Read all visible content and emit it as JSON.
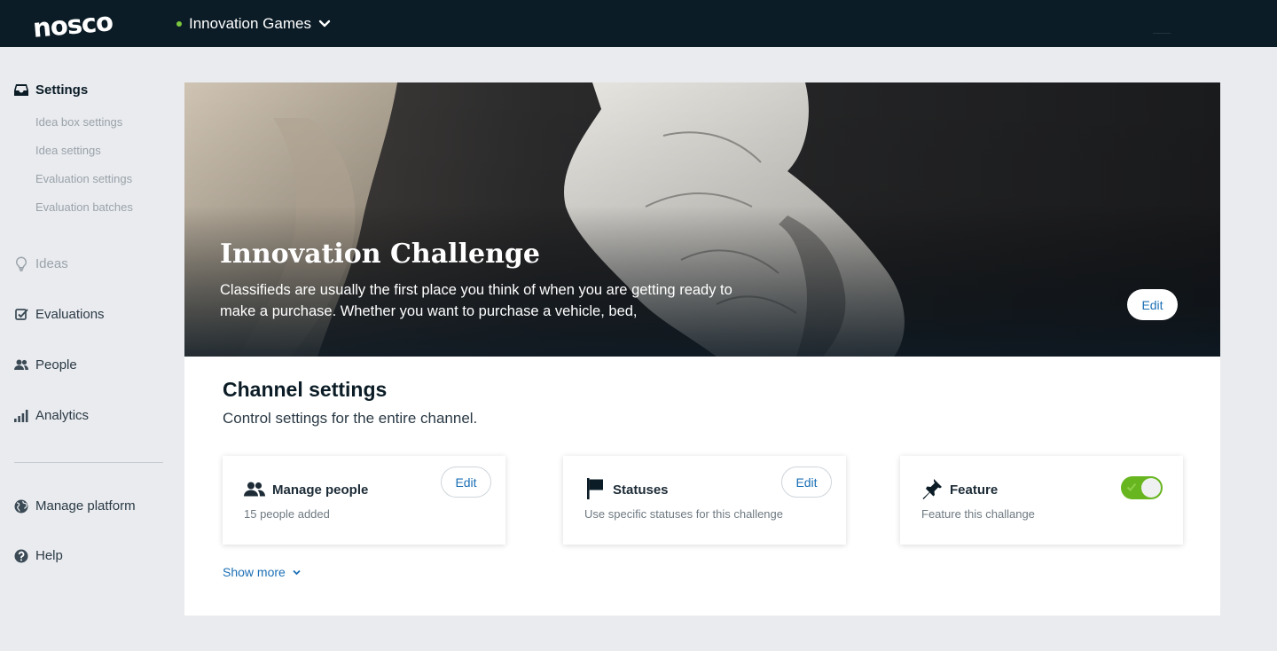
{
  "topbar": {
    "logo_text": "nosco",
    "workspace_name": "Innovation Games",
    "workspace_status_color": "#7bc63f"
  },
  "sidebar": {
    "settings_label": "Settings",
    "sub_items": [
      "Idea box settings",
      "Idea settings",
      "Evaluation settings",
      "Evaluation batches"
    ],
    "ideas_label": "Ideas",
    "evaluations_label": "Evaluations",
    "people_label": "People",
    "analytics_label": "Analytics",
    "manage_platform_label": "Manage platform",
    "help_label": "Help"
  },
  "hero": {
    "title": "Innovation Challenge",
    "description": "Classifieds are usually the first place you think of when you are getting ready to make a purchase. Whether you want to purchase a vehicle, bed,",
    "edit_label": "Edit"
  },
  "channel_settings": {
    "title": "Channel settings",
    "subtitle": "Control settings for the entire channel.",
    "cards": [
      {
        "title": "Manage people",
        "description": "15 people added",
        "edit_label": "Edit",
        "icon": "people-icon"
      },
      {
        "title": "Statuses",
        "description": "Use specific statuses for this challenge",
        "edit_label": "Edit",
        "icon": "flag-icon"
      },
      {
        "title": "Feature",
        "description": "Feature this challange",
        "toggle_on": true,
        "icon": "pin-icon"
      }
    ],
    "show_more_label": "Show more"
  },
  "colors": {
    "accent": "#1b6fb5",
    "topbar": "#0b1c26",
    "toggle_on": "#67b51f"
  }
}
